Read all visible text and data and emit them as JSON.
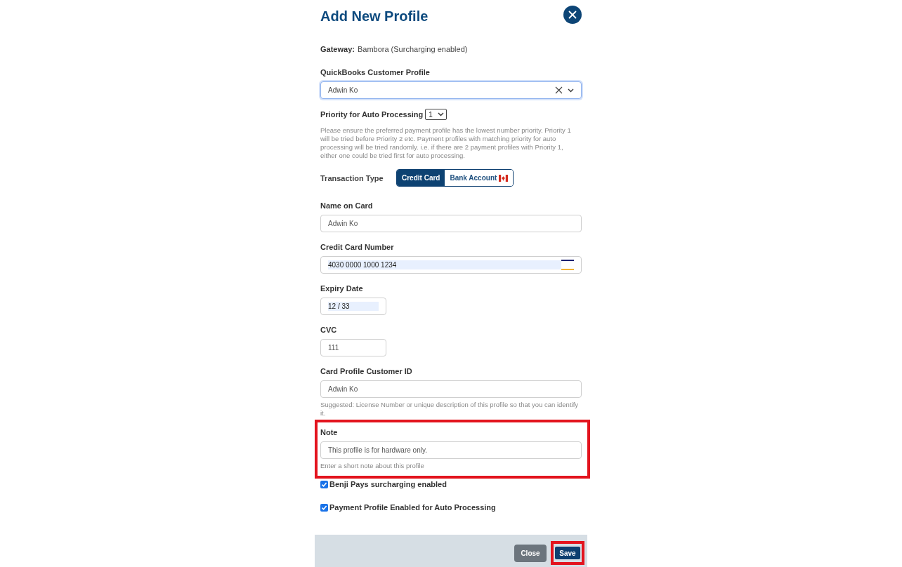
{
  "dialog": {
    "title": "Add New Profile"
  },
  "gateway": {
    "label": "Gateway:",
    "value": "Bambora (Surcharging enabled)"
  },
  "customer_profile": {
    "label": "QuickBooks Customer Profile",
    "value": "Adwin Ko",
    "focused": true
  },
  "priority": {
    "label": "Priority for Auto Processing",
    "value": "1",
    "help": "Please ensure the preferred payment profile has the lowest number priority. Priority 1 will be tried before Priority 2 etc. Payment profiles with matching priority for auto processing will be tried randomly. i.e. if there are 2 payment profiles with Priority 1, either one could be tried first for auto processing."
  },
  "transaction_type": {
    "label": "Transaction Type",
    "options": [
      {
        "label": "Credit Card",
        "selected": true,
        "kind": "plain"
      },
      {
        "label": "Bank Account",
        "selected": false,
        "kind": "flag"
      }
    ]
  },
  "fields": [
    {
      "kind": "full",
      "label": "Name on Card",
      "value": "Adwin Ko",
      "autofilled": false,
      "highlighted": false
    },
    {
      "kind": "card",
      "label": "Credit Card Number",
      "value": "4030 0000 1000 1234",
      "autofilled": true,
      "highlighted": false
    },
    {
      "kind": "short",
      "label": "Expiry Date",
      "value": "12 / 33",
      "autofilled": true,
      "highlighted": false
    },
    {
      "kind": "short",
      "label": "CVC",
      "value": "111",
      "autofilled": false,
      "highlighted": false
    },
    {
      "kind": "full",
      "label": "Card Profile Customer ID",
      "value": "Adwin Ko",
      "autofilled": false,
      "highlighted": false,
      "hint": "Suggested: License Number or unique description of this profile so that you can identify it."
    },
    {
      "kind": "full",
      "label": "Note",
      "value": "This profile is for hardware only.",
      "autofilled": false,
      "highlighted": true,
      "hint": "Enter a short note about this profile"
    }
  ],
  "checkboxes": [
    {
      "label": "Benji Pays surcharging enabled",
      "checked": true
    },
    {
      "label": "Payment Profile Enabled for Auto Processing",
      "checked": true
    }
  ],
  "footer": {
    "buttons": [
      {
        "label": "Close",
        "kind": "secondary",
        "highlighted": false
      },
      {
        "label": "Save",
        "kind": "primary",
        "highlighted": true
      }
    ]
  }
}
